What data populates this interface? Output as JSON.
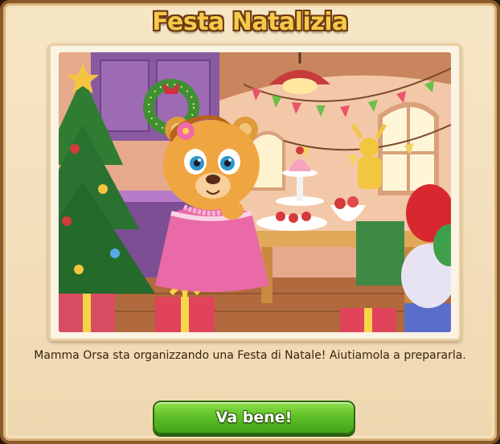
{
  "dialog": {
    "title": "Festa Natalizia",
    "message": "Mamma Orsa sta organizzando una Festa di Natale! Aiutiamola a prepararla.",
    "ok_label": "Va bene!"
  },
  "illustration": {
    "subject": "bear-character-christmas-party-scene"
  },
  "colors": {
    "frame_border": "#8a5a2b",
    "panel_bg": "#f7e6c6",
    "title_fill": "#f7c94a",
    "title_outline": "#6b3a12",
    "button_green": "#5cbe26",
    "text_dark": "#3a230f"
  }
}
